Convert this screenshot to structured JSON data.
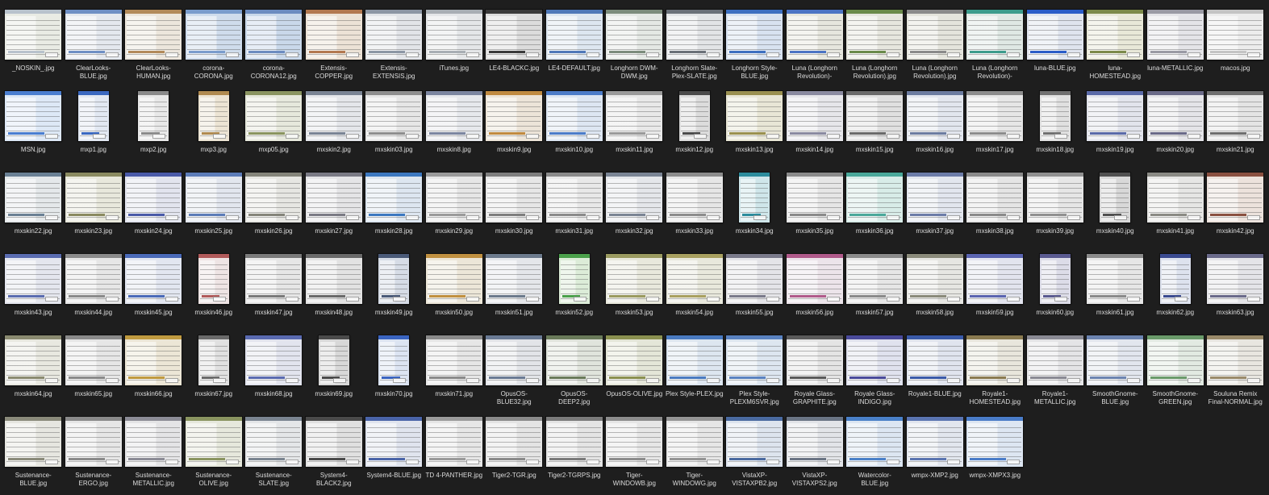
{
  "files": [
    {
      "name": "_NOSKIN_.jpg",
      "bg": "#e9ebe4",
      "tb": "#b8c2cc",
      "portrait": false
    },
    {
      "name": "ClearLooks-BLUE.jpg",
      "bg": "#e4e8ee",
      "tb": "#6e8fc4",
      "portrait": false
    },
    {
      "name": "ClearLooks-HUMAN.jpg",
      "bg": "#ece6dc",
      "tb": "#b28a5a",
      "portrait": false
    },
    {
      "name": "corona-CORONA.jpg",
      "bg": "#cfdcec",
      "tb": "#7a9ccc",
      "portrait": false
    },
    {
      "name": "corona-CORONA12.jpg",
      "bg": "#c9d8ea",
      "tb": "#6c8cc0",
      "portrait": false
    },
    {
      "name": "Extensis-COPPER.jpg",
      "bg": "#ece2d6",
      "tb": "#b27850",
      "portrait": false
    },
    {
      "name": "Extensis-EXTENSIS.jpg",
      "bg": "#e2e4e8",
      "tb": "#8c96a4",
      "portrait": false
    },
    {
      "name": "iTunes.jpg",
      "bg": "#e4e6e8",
      "tb": "#a8aeb4",
      "portrait": false
    },
    {
      "name": "LE4-BLACKC.jpg",
      "bg": "#dcdcdc",
      "tb": "#3a3a3a",
      "portrait": false
    },
    {
      "name": "LE4-DEFAULT.jpg",
      "bg": "#dde6f0",
      "tb": "#4f78b8",
      "portrait": false
    },
    {
      "name": "Longhorn DWM-DWM.jpg",
      "bg": "#e4e8e4",
      "tb": "#7c8c7c",
      "portrait": false
    },
    {
      "name": "Longhorn Slate-Plex-SLATE.jpg",
      "bg": "#e2e4e6",
      "tb": "#6a7078",
      "portrait": false
    },
    {
      "name": "Longhorn Style-BLUE.jpg",
      "bg": "#d8e2f0",
      "tb": "#3d6fc0",
      "portrait": false
    },
    {
      "name": "Luna (Longhorn Revolution)-BLUE.jpg",
      "bg": "#e6e6de",
      "tb": "#4c74c4",
      "portrait": false
    },
    {
      "name": "Luna (Longhorn Revolution).jpg",
      "bg": "#e6e6de",
      "tb": "#6a8a4a",
      "portrait": false
    },
    {
      "name": "Luna (Longhorn Revolution).jpg",
      "bg": "#e4e4dc",
      "tb": "#8a8a8a",
      "portrait": false
    },
    {
      "name": "Luna (Longhorn Revolution)-NEON.jpg",
      "bg": "#dfe8e4",
      "tb": "#3c9c8c",
      "portrait": false
    },
    {
      "name": "luna-BLUE.jpg",
      "bg": "#dfe4ee",
      "tb": "#2a5cc8",
      "portrait": false
    },
    {
      "name": "luna-HOMESTEAD.jpg",
      "bg": "#e8e8d8",
      "tb": "#7c8a4a",
      "portrait": false
    },
    {
      "name": "luna-METALLIC.jpg",
      "bg": "#e4e4e8",
      "tb": "#9a9aa4",
      "portrait": false
    },
    {
      "name": "macos.jpg",
      "bg": "#ececec",
      "tb": "#c4c4c4",
      "portrait": false
    },
    {
      "name": "MSN.jpg",
      "bg": "#dde8f6",
      "tb": "#4a7ed0",
      "portrait": false
    },
    {
      "name": "mxp1.jpg",
      "bg": "#e2e8f2",
      "tb": "#3a68c0",
      "portrait": true
    },
    {
      "name": "mxp2.jpg",
      "bg": "#e8e8e8",
      "tb": "#8a8a8a",
      "portrait": true
    },
    {
      "name": "mxp3.jpg",
      "bg": "#ece4d4",
      "tb": "#b08a50",
      "portrait": true
    },
    {
      "name": "mxp05.jpg",
      "bg": "#e6e8dc",
      "tb": "#8a9460",
      "portrait": false
    },
    {
      "name": "mxskin2.jpg",
      "bg": "#e4e6ea",
      "tb": "#7a8494",
      "portrait": false
    },
    {
      "name": "mxskin03.jpg",
      "bg": "#e6e6e6",
      "tb": "#8e8e8e",
      "portrait": false
    },
    {
      "name": "mxskin8.jpg",
      "bg": "#e6e8ec",
      "tb": "#7c86a0",
      "portrait": false
    },
    {
      "name": "mxskin9.jpg",
      "bg": "#ece4d8",
      "tb": "#c08a40",
      "portrait": false
    },
    {
      "name": "mxskin10.jpg",
      "bg": "#dde6f2",
      "tb": "#4c7cc8",
      "portrait": false
    },
    {
      "name": "mxskin11.jpg",
      "bg": "#e8e8e8",
      "tb": "#9a9a9a",
      "portrait": false
    },
    {
      "name": "mxskin12.jpg",
      "bg": "#dcdcdc",
      "tb": "#4a4a4a",
      "portrait": true
    },
    {
      "name": "mxskin13.jpg",
      "bg": "#e8e6d6",
      "tb": "#9a9050",
      "portrait": false
    },
    {
      "name": "mxskin14.jpg",
      "bg": "#e6e6ea",
      "tb": "#8a8aa0",
      "portrait": false
    },
    {
      "name": "mxskin15.jpg",
      "bg": "#e0e0e0",
      "tb": "#6a6a6a",
      "portrait": false
    },
    {
      "name": "mxskin16.jpg",
      "bg": "#e2e6ee",
      "tb": "#6c7ca0",
      "portrait": false
    },
    {
      "name": "mxskin17.jpg",
      "bg": "#e6e6e6",
      "tb": "#8c8c8c",
      "portrait": false
    },
    {
      "name": "mxskin18.jpg",
      "bg": "#e0e0e0",
      "tb": "#707070",
      "portrait": true
    },
    {
      "name": "mxskin19.jpg",
      "bg": "#e2e4ec",
      "tb": "#5a6aa8",
      "portrait": false
    },
    {
      "name": "mxskin20.jpg",
      "bg": "#e4e4e8",
      "tb": "#6a6a88",
      "portrait": false
    },
    {
      "name": "mxskin21.jpg",
      "bg": "#e4e4e4",
      "tb": "#6e6e6e",
      "portrait": false
    },
    {
      "name": "mxskin22.jpg",
      "bg": "#e4e8ea",
      "tb": "#6a8094",
      "portrait": false
    },
    {
      "name": "mxskin23.jpg",
      "bg": "#e8e8dc",
      "tb": "#8a8a60",
      "portrait": false
    },
    {
      "name": "mxskin24.jpg",
      "bg": "#e2e4ee",
      "tb": "#4a5aa8",
      "portrait": false
    },
    {
      "name": "mxskin25.jpg",
      "bg": "#e2e6ee",
      "tb": "#5c7cb8",
      "portrait": false
    },
    {
      "name": "mxskin26.jpg",
      "bg": "#e6e6e2",
      "tb": "#84847a",
      "portrait": false
    },
    {
      "name": "mxskin27.jpg",
      "bg": "#e4e4e6",
      "tb": "#7a7a84",
      "portrait": false
    },
    {
      "name": "mxskin28.jpg",
      "bg": "#dde6f0",
      "tb": "#3c78c0",
      "portrait": false
    },
    {
      "name": "mxskin29.jpg",
      "bg": "#e6e6e6",
      "tb": "#9a9a9a",
      "portrait": false
    },
    {
      "name": "mxskin30.jpg",
      "bg": "#e6e6e6",
      "tb": "#7e7e7e",
      "portrait": false
    },
    {
      "name": "mxskin31.jpg",
      "bg": "#e8e8e8",
      "tb": "#8a8a8a",
      "portrait": false
    },
    {
      "name": "mxskin32.jpg",
      "bg": "#e4e6ea",
      "tb": "#7a8494",
      "portrait": false
    },
    {
      "name": "mxskin33.jpg",
      "bg": "#e6e6e6",
      "tb": "#8c8c8c",
      "portrait": false
    },
    {
      "name": "mxskin34.jpg",
      "bg": "#cfe6ea",
      "tb": "#2c8c9c",
      "portrait": true
    },
    {
      "name": "mxskin35.jpg",
      "bg": "#e6e6e6",
      "tb": "#8a8a8a",
      "portrait": false
    },
    {
      "name": "mxskin36.jpg",
      "bg": "#d8ece8",
      "tb": "#4aa89a",
      "portrait": false
    },
    {
      "name": "mxskin37.jpg",
      "bg": "#e2e6ee",
      "tb": "#6c7ca8",
      "portrait": false
    },
    {
      "name": "mxskin38.jpg",
      "bg": "#e4e4e4",
      "tb": "#8a8a8a",
      "portrait": false
    },
    {
      "name": "mxskin39.jpg",
      "bg": "#e6e6e6",
      "tb": "#909090",
      "portrait": false
    },
    {
      "name": "mxskin40.jpg",
      "bg": "#d8d8d8",
      "tb": "#505050",
      "portrait": true
    },
    {
      "name": "mxskin41.jpg",
      "bg": "#e6e6e4",
      "tb": "#8a8a84",
      "portrait": false
    },
    {
      "name": "mxskin42.jpg",
      "bg": "#ece2dc",
      "tb": "#8a5040",
      "portrait": false
    },
    {
      "name": "mxskin43.jpg",
      "bg": "#e4e6ee",
      "tb": "#5a6cb0",
      "portrait": false
    },
    {
      "name": "mxskin44.jpg",
      "bg": "#e6e6e6",
      "tb": "#8a8a8a",
      "portrait": false
    },
    {
      "name": "mxskin45.jpg",
      "bg": "#e2e6f0",
      "tb": "#4a6ab8",
      "portrait": false
    },
    {
      "name": "mxskin46.jpg",
      "bg": "#eee4e4",
      "tb": "#b05a5a",
      "portrait": true
    },
    {
      "name": "mxskin47.jpg",
      "bg": "#e6e6e6",
      "tb": "#7a7a7a",
      "portrait": false
    },
    {
      "name": "mxskin48.jpg",
      "bg": "#e2e2e2",
      "tb": "#6a6a6a",
      "portrait": false
    },
    {
      "name": "mxskin49.jpg",
      "bg": "#d6dce6",
      "tb": "#4a5a78",
      "portrait": true
    },
    {
      "name": "mxskin50.jpg",
      "bg": "#ece6d8",
      "tb": "#c09040",
      "portrait": false
    },
    {
      "name": "mxskin51.jpg",
      "bg": "#e4e6ea",
      "tb": "#6c7a8c",
      "portrait": false
    },
    {
      "name": "mxskin52.jpg",
      "bg": "#dcecd8",
      "tb": "#4aa04a",
      "portrait": true
    },
    {
      "name": "mxskin53.jpg",
      "bg": "#e8e8dc",
      "tb": "#9a9a60",
      "portrait": false
    },
    {
      "name": "mxskin54.jpg",
      "bg": "#e8e8dc",
      "tb": "#a8a060",
      "portrait": false
    },
    {
      "name": "mxskin55.jpg",
      "bg": "#e4e4e8",
      "tb": "#7a7a8a",
      "portrait": false
    },
    {
      "name": "mxskin56.jpg",
      "bg": "#ece4ea",
      "tb": "#b05a8a",
      "portrait": false
    },
    {
      "name": "mxskin57.jpg",
      "bg": "#e6e6e6",
      "tb": "#8a8a8a",
      "portrait": false
    },
    {
      "name": "mxskin58.jpg",
      "bg": "#e6e6e2",
      "tb": "#8a8a7a",
      "portrait": false
    },
    {
      "name": "mxskin59.jpg",
      "bg": "#e2e4ee",
      "tb": "#5a64b0",
      "portrait": false
    },
    {
      "name": "mxskin60.jpg",
      "bg": "#dcdce8",
      "tb": "#5a5a90",
      "portrait": true
    },
    {
      "name": "mxskin61.jpg",
      "bg": "#e6e6e6",
      "tb": "#8a8a8a",
      "portrait": false
    },
    {
      "name": "mxskin62.jpg",
      "bg": "#dde2ee",
      "tb": "#3a4a90",
      "portrait": true
    },
    {
      "name": "mxskin63.jpg",
      "bg": "#e4e4e8",
      "tb": "#6a6a8a",
      "portrait": false
    },
    {
      "name": "mxskin64.jpg",
      "bg": "#e8e8e0",
      "tb": "#8a8a70",
      "portrait": false
    },
    {
      "name": "mxskin65.jpg",
      "bg": "#e6e6e6",
      "tb": "#8a8a8a",
      "portrait": false
    },
    {
      "name": "mxskin66.jpg",
      "bg": "#ece6d6",
      "tb": "#c09a40",
      "portrait": false
    },
    {
      "name": "mxskin67.jpg",
      "bg": "#e0e0e0",
      "tb": "#6a6a6a",
      "portrait": true
    },
    {
      "name": "mxskin68.jpg",
      "bg": "#e2e4ee",
      "tb": "#5a6ab0",
      "portrait": false
    },
    {
      "name": "mxskin69.jpg",
      "bg": "#d8d8d8",
      "tb": "#4a4a4a",
      "portrait": true
    },
    {
      "name": "mxskin70.jpg",
      "bg": "#dce4f2",
      "tb": "#3a64c0",
      "portrait": true
    },
    {
      "name": "mxskin71.jpg",
      "bg": "#e6e6e6",
      "tb": "#8a8a8a",
      "portrait": false
    },
    {
      "name": "OpusOS-BLUE32.jpg",
      "bg": "#e2e4e8",
      "tb": "#6a7a94",
      "portrait": false
    },
    {
      "name": "OpusOS-DEEP2.jpg",
      "bg": "#e0e4dc",
      "tb": "#6a7a5a",
      "portrait": false
    },
    {
      "name": "OpusOS-OLIVE.jpg",
      "bg": "#e4e6d8",
      "tb": "#8a9050",
      "portrait": false
    },
    {
      "name": "Plex Style-PLEX.jpg",
      "bg": "#dde6f0",
      "tb": "#4a7ac0",
      "portrait": false
    },
    {
      "name": "Plex Style-PLEXM6SVR.jpg",
      "bg": "#dde6f0",
      "tb": "#5a82c0",
      "portrait": false
    },
    {
      "name": "Royale Glass-GRAPHITE.jpg",
      "bg": "#e4e4e4",
      "tb": "#5a5a5a",
      "portrait": false
    },
    {
      "name": "Royale Glass-INDIGO.jpg",
      "bg": "#e0e2ee",
      "tb": "#4a4a9a",
      "portrait": false
    },
    {
      "name": "Royale1-BLUE.jpg",
      "bg": "#e0e4ee",
      "tb": "#3a5aa8",
      "portrait": false
    },
    {
      "name": "Royale1-HOMESTEAD.jpg",
      "bg": "#e8e6dc",
      "tb": "#8a7a50",
      "portrait": false
    },
    {
      "name": "Royale1-METALLIC.jpg",
      "bg": "#e4e4e6",
      "tb": "#8a8a94",
      "portrait": false
    },
    {
      "name": "SmoothGnome-BLUE.jpg",
      "bg": "#e2e6ee",
      "tb": "#6c84b0",
      "portrait": false
    },
    {
      "name": "SmoothGnome-GREEN.jpg",
      "bg": "#e2eae2",
      "tb": "#6a9a6a",
      "portrait": false
    },
    {
      "name": "Souluna Remix Final-NORMAL.jpg",
      "bg": "#e8e6e0",
      "tb": "#9a8a6a",
      "portrait": false
    },
    {
      "name": "Sustenance-BLUE.jpg",
      "bg": "#e6e6e0",
      "tb": "#8a8a7a",
      "portrait": false
    },
    {
      "name": "Sustenance-ERGO.jpg",
      "bg": "#e6e6e6",
      "tb": "#8a8a8a",
      "portrait": false
    },
    {
      "name": "Sustenance-METALLIC.jpg",
      "bg": "#e4e4e6",
      "tb": "#8c8c96",
      "portrait": false
    },
    {
      "name": "Sustenance-OLIVE.jpg",
      "bg": "#e6e8dc",
      "tb": "#8a9460",
      "portrait": false
    },
    {
      "name": "Sustenance-SLATE.jpg",
      "bg": "#e4e6e8",
      "tb": "#7a8490",
      "portrait": false
    },
    {
      "name": "System4-BLACK2.jpg",
      "bg": "#e0e0e0",
      "tb": "#4a4a4a",
      "portrait": false
    },
    {
      "name": "System4-BLUE.jpg",
      "bg": "#e0e4ee",
      "tb": "#4a64a8",
      "portrait": false
    },
    {
      "name": "TD 4-PANTHER.jpg",
      "bg": "#e6e6e6",
      "tb": "#9a9a9a",
      "portrait": false
    },
    {
      "name": "Tiger2-TGR.jpg",
      "bg": "#e4e4e4",
      "tb": "#8a8a8a",
      "portrait": false
    },
    {
      "name": "Tiger2-TGRPS.jpg",
      "bg": "#e4e4e4",
      "tb": "#7a7a7a",
      "portrait": false
    },
    {
      "name": "Tiger-WINDOWB.jpg",
      "bg": "#e6e6e6",
      "tb": "#8c8c8c",
      "portrait": false
    },
    {
      "name": "Tiger-WINDOWG.jpg",
      "bg": "#e6e6e6",
      "tb": "#949494",
      "portrait": false
    },
    {
      "name": "VistaXP-VISTAXPB2.jpg",
      "bg": "#dde4ee",
      "tb": "#4a6aa0",
      "portrait": false
    },
    {
      "name": "VistaXP-VISTAXPS2.jpg",
      "bg": "#e2e4e8",
      "tb": "#6a7484",
      "portrait": false
    },
    {
      "name": "Watercolor-BLUE.jpg",
      "bg": "#dce6f2",
      "tb": "#4a80c8",
      "portrait": false
    },
    {
      "name": "wmpx-XMP2.jpg",
      "bg": "#e2e6ee",
      "tb": "#5a74b0",
      "portrait": false
    },
    {
      "name": "wmpx-XMPX3.jpg",
      "bg": "#dde6f2",
      "tb": "#4a7cc8",
      "portrait": false
    }
  ]
}
